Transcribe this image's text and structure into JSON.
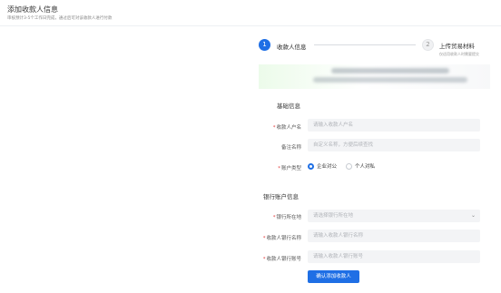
{
  "header": {
    "title": "添加收款人信息",
    "subtitle": "审核预计3-5个工作日完成，通过后可对该收款人进行付款"
  },
  "stepper": {
    "steps": [
      {
        "number": "1",
        "label": "收款人信息",
        "active": true
      },
      {
        "number": "2",
        "label": "上传贸易材料",
        "description": "仅适用收款人时需要提交",
        "active": false
      }
    ]
  },
  "banner": {
    "status": "blurred / obscured content"
  },
  "basic_section": {
    "title": "基础信息",
    "payee_name": {
      "label": "收款人户名",
      "required": true,
      "placeholder": "请输入收款人户名"
    },
    "remark_name": {
      "label": "备注名称",
      "required": false,
      "placeholder": "自定义名称，方便后续查找"
    },
    "account_type": {
      "label": "账户类型",
      "required": true,
      "options": [
        "企业对公",
        "个人对私"
      ],
      "selected": "企业对公"
    }
  },
  "bank_section": {
    "title": "银行账户信息",
    "bank_location": {
      "label": "银行所在地",
      "required": true,
      "placeholder": "请选择银行所在地"
    },
    "bank_name": {
      "label": "收款人银行名称",
      "required": true,
      "placeholder": "请输入收款人银行名称"
    },
    "account_number": {
      "label": "收款人银行账号",
      "required": true,
      "placeholder": "请输入收款人银行账号"
    }
  },
  "actions": {
    "submit_label": "确认添加收款人"
  },
  "colors": {
    "primary": "#1f6fe5",
    "required": "#e33b3b",
    "input_bg": "#f3f4f6"
  }
}
